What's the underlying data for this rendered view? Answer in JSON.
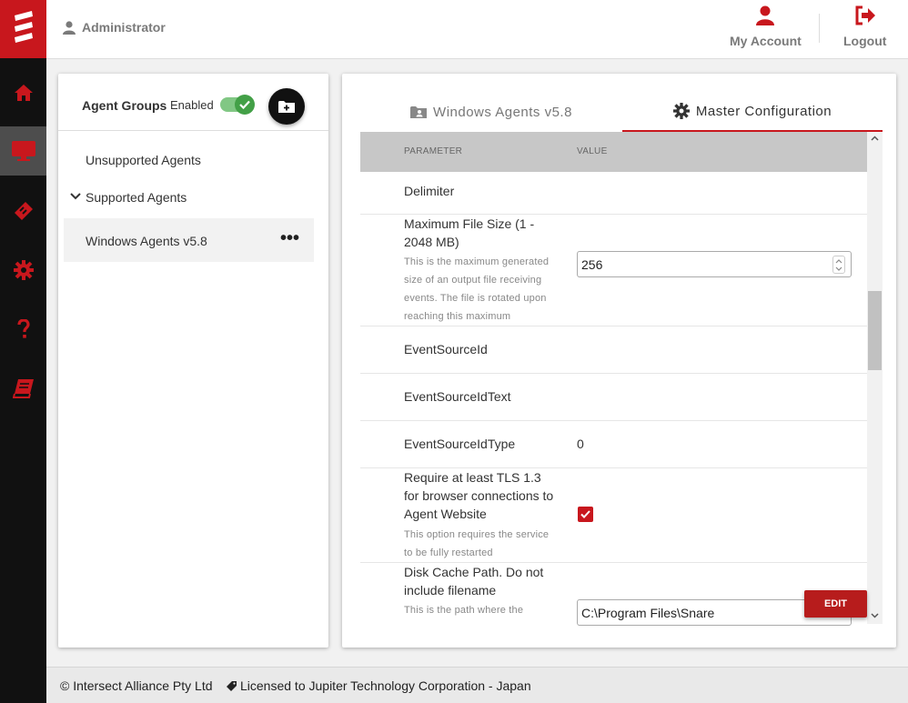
{
  "header": {
    "user": "Administrator",
    "my_account": "My Account",
    "logout": "Logout"
  },
  "agent_groups": {
    "title": "Agent Groups",
    "enabled_label": "Enabled",
    "enabled": true,
    "items": [
      {
        "label": "Unsupported Agents"
      },
      {
        "label": "Supported Agents"
      },
      {
        "label": "Windows Agents v5.8"
      }
    ]
  },
  "tabs": [
    {
      "label": "Windows Agents v5.8",
      "icon": "folder-user-icon"
    },
    {
      "label": "Master Configuration",
      "icon": "gear-icon"
    }
  ],
  "table": {
    "columns": [
      "PARAMETER",
      "VALUE"
    ],
    "rows": [
      {
        "name": "Delimiter"
      },
      {
        "name": "Maximum File Size (1 - 2048 MB)",
        "description": "This is the maximum generated size of an output file receiving events. The file is rotated upon reaching this maximum",
        "value": "256"
      },
      {
        "name": "EventSourceId"
      },
      {
        "name": "EventSourceIdText"
      },
      {
        "name": "EventSourceIdType",
        "value": "0"
      },
      {
        "name": "Require at least TLS 1.3 for browser connections to Agent Website",
        "description": "This option requires the service to be fully restarted",
        "checked": true
      },
      {
        "name": "Disk Cache Path. Do not include filename",
        "description": "This is the path where the",
        "value": "C:\\Program Files\\Snare"
      }
    ]
  },
  "edit_button": "EDIT",
  "footer": {
    "copyright": "© Intersect Alliance Pty Ltd",
    "license": "Licensed to Jupiter Technology Corporation - Japan"
  },
  "colors": {
    "brand": "#c8171d",
    "toggle": "#43a047"
  }
}
